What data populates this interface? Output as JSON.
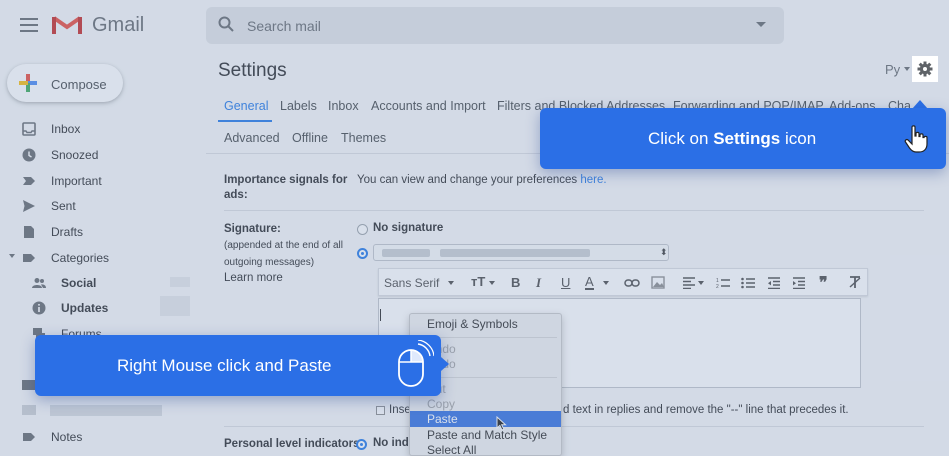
{
  "app": {
    "name": "Gmail"
  },
  "search": {
    "placeholder": "Search mail"
  },
  "compose": {
    "label": "Compose"
  },
  "sidebar": {
    "items": [
      {
        "label": "Inbox",
        "icon": "inbox-icon"
      },
      {
        "label": "Snoozed",
        "icon": "clock-icon"
      },
      {
        "label": "Important",
        "icon": "important-icon"
      },
      {
        "label": "Sent",
        "icon": "send-icon"
      },
      {
        "label": "Drafts",
        "icon": "draft-icon"
      },
      {
        "label": "Categories",
        "icon": "label-icon"
      },
      {
        "label": "Social",
        "icon": "people-icon"
      },
      {
        "label": "Updates",
        "icon": "info-icon"
      },
      {
        "label": "Forums",
        "icon": "forum-icon"
      },
      {
        "label": "Notes",
        "icon": "label-icon"
      }
    ]
  },
  "settings": {
    "title": "Settings",
    "language": "Ру",
    "tabs_row1": [
      "General",
      "Labels",
      "Inbox",
      "Accounts and Import",
      "Filters and Blocked Addresses",
      "Forwarding and POP/IMAP",
      "Add-ons",
      "Cha"
    ],
    "tabs_row2": [
      "Advanced",
      "Offline",
      "Themes"
    ],
    "importance": {
      "label": "Importance signals for ads:",
      "text": "You can view and change your preferences ",
      "link": "here."
    },
    "signature": {
      "label": "Signature:",
      "sub1": "(appended at the end of all",
      "sub2": "outgoing messages)",
      "learn_more": "Learn more",
      "no_signature": "No signature",
      "font": "Sans Serif",
      "insert_text": "Inse",
      "insert_rest": "d text in replies and remove the \"--\" line that precedes it."
    },
    "personal": {
      "label": "Personal level indicators:",
      "option": "No indi"
    }
  },
  "context_menu": {
    "items": [
      "Emoji & Symbols",
      "Undo",
      "Redo",
      "Cut",
      "Copy",
      "Paste",
      "Paste and Match Style",
      "Select All"
    ],
    "highlighted": "Paste"
  },
  "callouts": {
    "settings_pre": "Click on ",
    "settings_bold": "Settings",
    "settings_post": " icon",
    "paste": "Right Mouse click and Paste"
  },
  "colors": {
    "accent": "#1a73e8",
    "callout": "#2b6fe6"
  }
}
